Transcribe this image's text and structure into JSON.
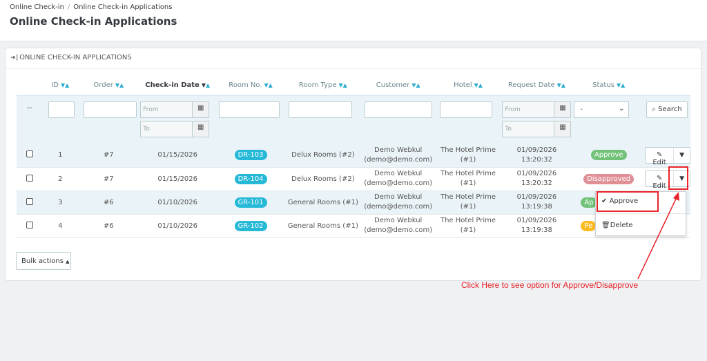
{
  "breadcrumb": {
    "item1": "Online Check-in",
    "sep": "/",
    "item2": "Online Check-in Applications"
  },
  "page_title": "Online Check-in Applications",
  "panel": {
    "icon": "sign-in-icon",
    "heading": "ONLINE CHECK-IN APPLICATIONS"
  },
  "columns": {
    "id": "ID",
    "order": "Order",
    "checkin_date": "Check-in Date",
    "room_no": "Room No.",
    "room_type": "Room Type",
    "customer": "Customer",
    "hotel": "Hotel",
    "request_date": "Request Date",
    "status": "Status"
  },
  "filters": {
    "id_placeholder": "--",
    "from_placeholder": "From",
    "to_placeholder": "To",
    "status_value": "-",
    "search_label": "Search"
  },
  "rows": [
    {
      "id": "1",
      "order": "#7",
      "checkin": "01/15/2026",
      "room": "DR-103",
      "room_type": "Delux Rooms (#2)",
      "customer_name": "Demo Webkul",
      "customer_email": "(demo@demo.com)",
      "hotel_name": "The Hotel Prime",
      "hotel_id": "(#1)",
      "req_date": "01/09/2026",
      "req_time": "13:20:32",
      "status": "Approve",
      "edit": "Edit"
    },
    {
      "id": "2",
      "order": "#7",
      "checkin": "01/15/2026",
      "room": "DR-104",
      "room_type": "Delux Rooms (#2)",
      "customer_name": "Demo Webkul",
      "customer_email": "(demo@demo.com)",
      "hotel_name": "The Hotel Prime",
      "hotel_id": "(#1)",
      "req_date": "01/09/2026",
      "req_time": "13:20:32",
      "status": "Disapproved",
      "edit": "Edit"
    },
    {
      "id": "3",
      "order": "#6",
      "checkin": "01/10/2026",
      "room": "GR-101",
      "room_type": "General Rooms (#1)",
      "customer_name": "Demo Webkul",
      "customer_email": "(demo@demo.com)",
      "hotel_name": "The Hotel Prime",
      "hotel_id": "(#1)",
      "req_date": "01/09/2026",
      "req_time": "13:19:38",
      "status": "Ap",
      "edit": ""
    },
    {
      "id": "4",
      "order": "#6",
      "checkin": "01/10/2026",
      "room": "GR-102",
      "room_type": "General Rooms (#1)",
      "customer_name": "Demo Webkul",
      "customer_email": "(demo@demo.com)",
      "hotel_name": "The Hotel Prime",
      "hotel_id": "(#1)",
      "req_date": "01/09/2026",
      "req_time": "13:19:38",
      "status": "Pe",
      "edit": ""
    }
  ],
  "dropdown": {
    "approve": "Approve",
    "delete": "Delete"
  },
  "bulk_actions": "Bulk actions",
  "annotation": "Click Here to see option for Approve/Disapprove",
  "colors": {
    "accent": "#25b9d7",
    "approve": "#72c279",
    "disapproved": "#e08f95",
    "pending": "#fbbb22",
    "annotation": "#e8232a"
  }
}
